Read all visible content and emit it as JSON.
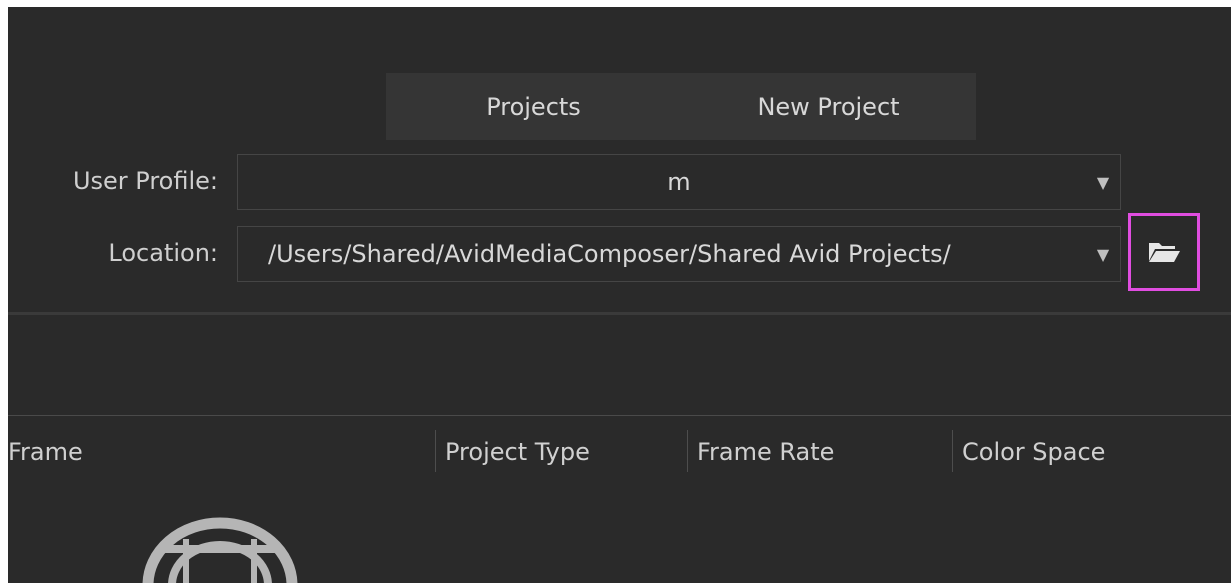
{
  "tabs": [
    {
      "label": "Projects"
    },
    {
      "label": "New Project"
    }
  ],
  "user_profile": {
    "label": "User Profile:",
    "value": "m"
  },
  "location": {
    "label": "Location:",
    "value": "/Users/Shared/AvidMediaComposer/Shared Avid Projects/"
  },
  "columns": [
    {
      "label": "Frame"
    },
    {
      "label": "Project Type"
    },
    {
      "label": "Frame Rate"
    },
    {
      "label": "Color Space"
    }
  ],
  "icons": [
    "chevron-down-icon",
    "folder-open-icon",
    "avid-logo"
  ]
}
